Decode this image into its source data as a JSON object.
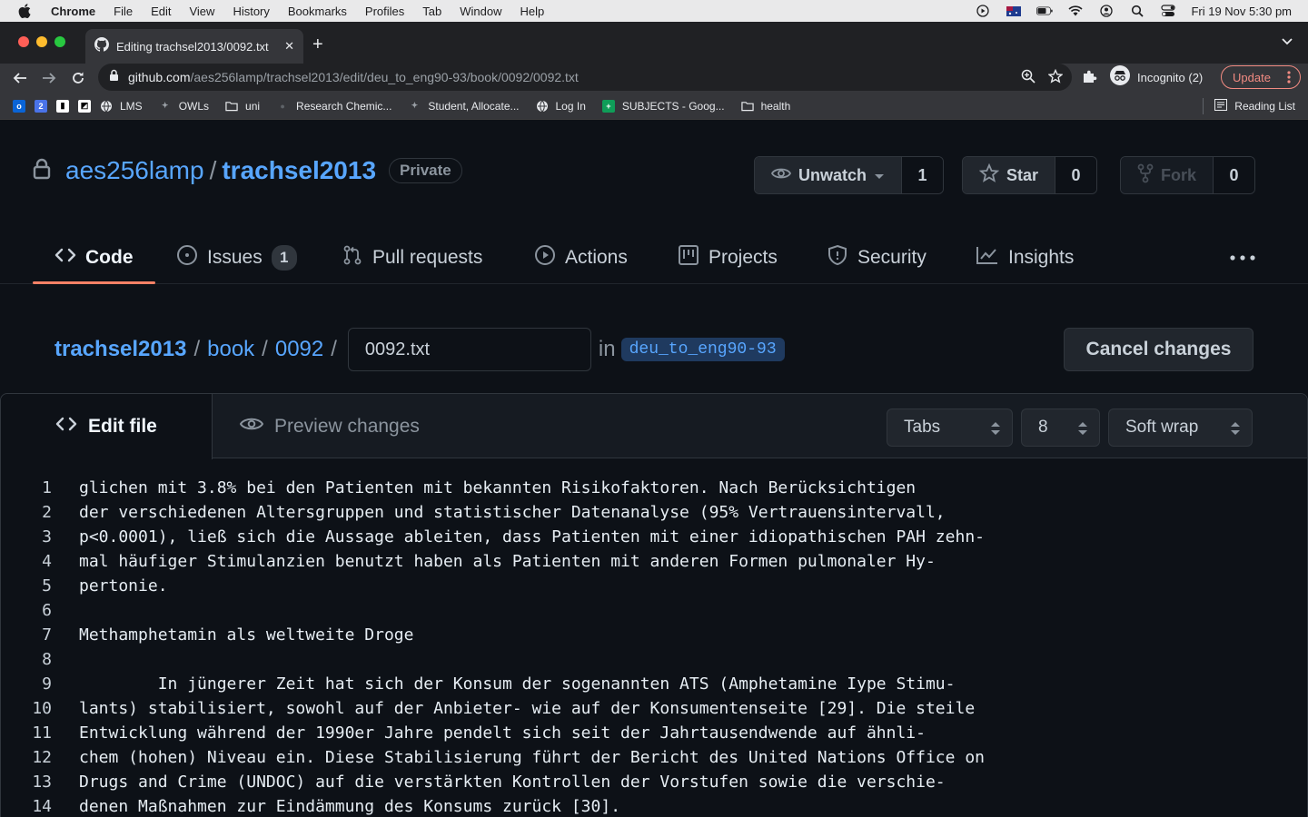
{
  "menubar": {
    "app": "Chrome",
    "items": [
      "File",
      "Edit",
      "View",
      "History",
      "Bookmarks",
      "Profiles",
      "Tab",
      "Window",
      "Help"
    ],
    "clock": "Fri 19 Nov  5:30 pm"
  },
  "browser": {
    "tab_title": "Editing trachsel2013/0092.txt",
    "url_host": "github.com",
    "url_path": "/aes256lamp/trachsel2013/edit/deu_to_eng90-93/book/0092/0092.txt",
    "incognito_label": "Incognito (2)",
    "update_label": "Update",
    "reading_list": "Reading List",
    "bookmarks": [
      {
        "label": "LMS",
        "icon": "globe-icon"
      },
      {
        "label": "OWLs",
        "icon": "owl-icon"
      },
      {
        "label": "uni",
        "icon": "folder-icon"
      },
      {
        "label": "Research Chemic...",
        "icon": "site-icon"
      },
      {
        "label": "Student, Allocate...",
        "icon": "owl-icon"
      },
      {
        "label": "Log In",
        "icon": "globe-icon"
      },
      {
        "label": "SUBJECTS - Goog...",
        "icon": "sheets-icon"
      },
      {
        "label": "health",
        "icon": "folder-icon"
      }
    ]
  },
  "repo": {
    "owner": "aes256lamp",
    "name": "trachsel2013",
    "visibility": "Private",
    "unwatch_label": "Unwatch",
    "watch_count": "1",
    "star_label": "Star",
    "star_count": "0",
    "fork_label": "Fork",
    "fork_count": "0"
  },
  "nav": {
    "code": "Code",
    "issues": "Issues",
    "issues_count": "1",
    "pulls": "Pull requests",
    "actions": "Actions",
    "projects": "Projects",
    "security": "Security",
    "insights": "Insights"
  },
  "path": {
    "repo": "trachsel2013",
    "dir1": "book",
    "dir2": "0092",
    "filename": "0092.txt",
    "in_label": "in",
    "branch": "deu_to_eng90-93",
    "cancel_label": "Cancel changes"
  },
  "editor": {
    "edit_tab": "Edit file",
    "preview_tab": "Preview changes",
    "indent_mode": "Tabs",
    "indent_size": "8",
    "wrap_mode": "Soft wrap",
    "lines": [
      {
        "n": "1",
        "text": "glichen mit 3.8% bei den Patienten mit bekannten Risikofaktoren. Nach Berücksichtigen"
      },
      {
        "n": "2",
        "text": "der verschiedenen Altersgruppen und statistischer Datenanalyse (95% Vertrauensintervall,"
      },
      {
        "n": "3",
        "text": "p<0.0001), ließ sich die Aussage ableiten, dass Patienten mit einer idiopathischen PAH zehn-"
      },
      {
        "n": "4",
        "text": "mal häufiger Stimulanzien benutzt haben als Patienten mit anderen Formen pulmonaler Hy-"
      },
      {
        "n": "5",
        "text": "pertonie."
      },
      {
        "n": "6",
        "text": ""
      },
      {
        "n": "7",
        "text": "Methamphetamin als weltweite Droge"
      },
      {
        "n": "8",
        "text": ""
      },
      {
        "n": "9",
        "text": "        In jüngerer Zeit hat sich der Konsum der sogenannten ATS (Amphetamine Iype Stimu-"
      },
      {
        "n": "10",
        "text": "lants) stabilisiert, sowohl auf der Anbieter- wie auf der Konsumentenseite [29]. Die steile"
      },
      {
        "n": "11",
        "text": "Entwicklung während der 1990er Jahre pendelt sich seit der Jahrtausendwende auf ähnli-"
      },
      {
        "n": "12",
        "text": "chem (hohen) Niveau ein. Diese Stabilisierung führt der Bericht des United Nations Office on"
      },
      {
        "n": "13",
        "text": "Drugs and Crime (UNDOC) auf die verstärkten Kontrollen der Vorstufen sowie die verschie-"
      },
      {
        "n": "14",
        "text": "denen Maßnahmen zur Eindämmung des Konsums zurück [30]."
      }
    ]
  }
}
